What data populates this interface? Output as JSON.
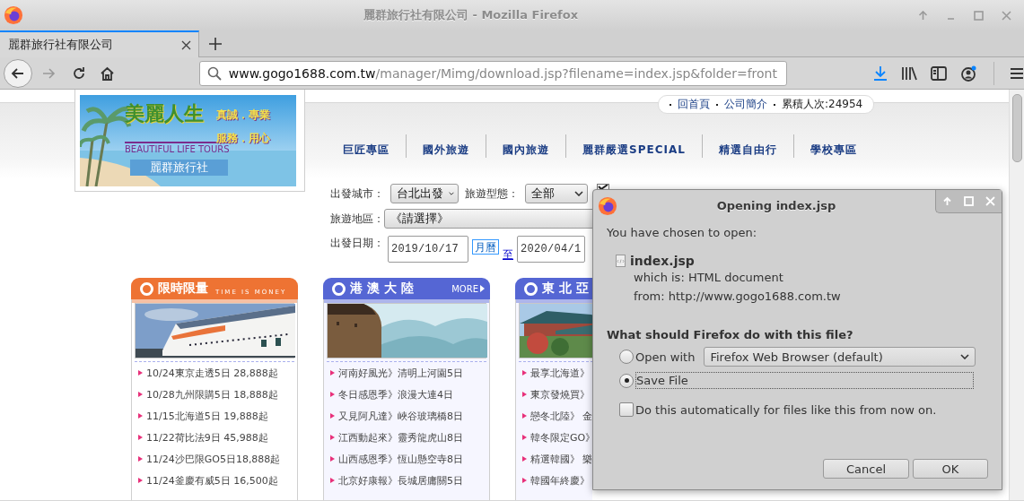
{
  "window": {
    "title": "麗群旅行社有限公司 - Mozilla Firefox"
  },
  "tabs": [
    {
      "label": "麗群旅行社有限公司",
      "selected": true
    }
  ],
  "url": {
    "host": "www.gogo1688.com.tw",
    "path": "/manager/Mimg/download.jsp?filename=index.jsp&folder=front"
  },
  "logo": {
    "name": "美麗人生",
    "english": "BEAUTIFUL LIFE TOURS",
    "company": "麗群旅行社",
    "slogans": [
      "真誠．專業",
      "服務．用心"
    ]
  },
  "top_links": [
    {
      "kind": "link",
      "text": "回首頁"
    },
    {
      "kind": "link",
      "text": "公司簡介"
    },
    {
      "kind": "text",
      "text": "累積人次:24954"
    }
  ],
  "nav_menu": [
    "巨匠專區",
    "國外旅遊",
    "國內旅遊",
    "麗群嚴選SPECIAL",
    "精選自由行",
    "學校專區"
  ],
  "search_form": {
    "rows": [
      {
        "items": [
          {
            "kind": "label",
            "text": "出發城市："
          },
          {
            "kind": "select",
            "value": "台北出發"
          },
          {
            "kind": "label",
            "text": "旅遊型態："
          },
          {
            "kind": "select",
            "value": "全部"
          },
          {
            "kind": "checkbox",
            "checked": true
          }
        ]
      },
      {
        "items": [
          {
            "kind": "label",
            "text": "旅遊地區："
          },
          {
            "kind": "select",
            "value": "《請選擇》"
          }
        ]
      },
      {
        "items": [
          {
            "kind": "label",
            "text": "出發日期："
          },
          {
            "kind": "input",
            "value": "2019/10/17"
          },
          {
            "kind": "button",
            "text": "月曆"
          },
          {
            "kind": "link",
            "text": "至"
          },
          {
            "kind": "input",
            "value": "2020/04/1"
          }
        ]
      }
    ]
  },
  "cards": [
    {
      "title": "限時限量",
      "subtitle": "TIME IS MONEY",
      "color": "#ee7333",
      "items": [
        "10/24東京走透5日 28,888起",
        "10/28九州限購5日 18,888起",
        "11/15北海道5日 19,888起",
        "11/22荷比法9日 45,988起",
        "11/24沙巴限GO5日18,888起",
        "11/24釜慶有威5日 16,500起"
      ]
    },
    {
      "title": "港 澳 大 陸",
      "more": "MORE",
      "color": "#5566d4",
      "items": [
        "河南好風光》清明上河園5日",
        "冬日感恩季》浪漫大連4日",
        "又見阿凡達》峽谷玻璃橋8日",
        "江西動起來》靈秀龍虎山8日",
        "山西感恩季》恆山懸空寺8日",
        "北京好康報》長城居庸關5日"
      ]
    },
    {
      "title": "東 北 亞",
      "color": "#5566d4",
      "items": [
        "最享北海道》",
        "東京發燒買》",
        "戀冬北陸》 金",
        "韓冬限定GO》",
        "精選韓國》 樂",
        "韓國年終慶》"
      ]
    }
  ],
  "dialog": {
    "title": "Opening index.jsp",
    "intro": "You have chosen to open:",
    "file_name": "index.jsp",
    "file_type": "which is: HTML document",
    "source": "from: http://www.gogo1688.com.tw",
    "question": "What should Firefox do with this file?",
    "options": [
      {
        "label": "Open with",
        "selected": false,
        "app": "Firefox Web Browser (default)"
      },
      {
        "label": "Save File",
        "selected": true
      }
    ],
    "remember": {
      "label": "Do this automatically for files like this from now on.",
      "checked": false
    },
    "buttons": [
      "Cancel",
      "OK"
    ]
  }
}
